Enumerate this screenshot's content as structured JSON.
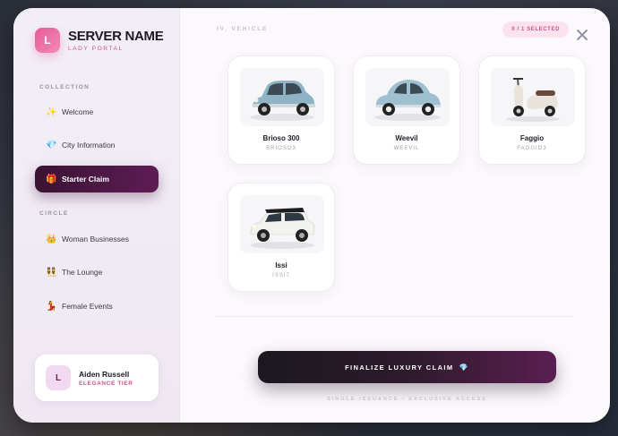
{
  "brand": {
    "logo_letter": "L",
    "title": "SERVER NAME",
    "subtitle": "LADY PORTAL"
  },
  "sidebar": {
    "sections": [
      {
        "label": "COLLECTION"
      },
      {
        "label": "CIRCLE"
      }
    ],
    "items": [
      {
        "label": "Welcome",
        "icon": "sparkles-icon",
        "glyph": "✨",
        "active": false
      },
      {
        "label": "City Information",
        "icon": "diamond-icon",
        "glyph": "💎",
        "active": false
      },
      {
        "label": "Starter Claim",
        "icon": "gift-icon",
        "glyph": "🎁",
        "active": true
      },
      {
        "label": "Woman Businesses",
        "icon": "crown-icon",
        "glyph": "👑",
        "active": false
      },
      {
        "label": "The Lounge",
        "icon": "friends-icon",
        "glyph": "👯",
        "active": false
      },
      {
        "label": "Female Events",
        "icon": "dancer-icon",
        "glyph": "💃",
        "active": false
      }
    ]
  },
  "user": {
    "avatar_letter": "L",
    "name": "Aiden Russell",
    "tier": "ELEGANCE TIER"
  },
  "main": {
    "section_title": "IV. VEHICLE",
    "selected_badge": "0 / 1 SELECTED",
    "vehicles": [
      {
        "name": "Brioso 300",
        "code": "BRIOSO3",
        "color": "#8fb3c4"
      },
      {
        "name": "Weevil",
        "code": "WEEVIL",
        "color": "#9fc0d0"
      },
      {
        "name": "Faggio",
        "code": "FAGGIO3",
        "color": "#e8e4dc"
      },
      {
        "name": "Issi",
        "code": "ISSI7",
        "color": "#f2f2ef"
      }
    ],
    "finalize_label": "FINALIZE LUXURY CLAIM",
    "finalize_icon": "💎",
    "footnote": "SINGLE ISSUANCE • EXCLUSIVE ACCESS"
  }
}
